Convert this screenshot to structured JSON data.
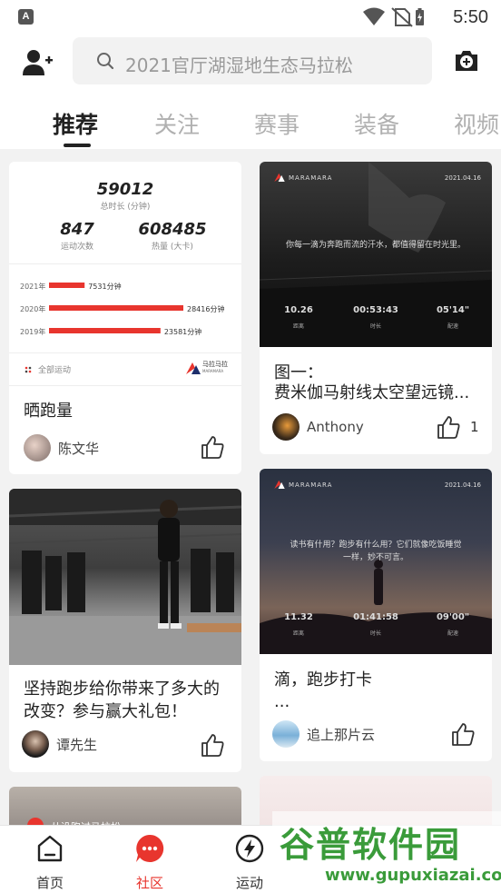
{
  "status": {
    "app_badge": "A",
    "time": "5:50"
  },
  "search": {
    "placeholder": "2021官厅湖湿地生态马拉松"
  },
  "tabs": [
    {
      "label": "推荐",
      "active": true
    },
    {
      "label": "关注"
    },
    {
      "label": "赛事"
    },
    {
      "label": "装备"
    },
    {
      "label": "视频"
    }
  ],
  "cards": {
    "stats": {
      "total_value": "59012",
      "total_label": "总时长 (分钟)",
      "runs_value": "847",
      "runs_label": "运动次数",
      "cal_value": "608485",
      "cal_label": "热量 (大卡)",
      "bars": [
        {
          "year": "2021年",
          "value": "7531分钟",
          "minutes": 7531
        },
        {
          "year": "2020年",
          "value": "28416分钟",
          "minutes": 28416
        },
        {
          "year": "2019年",
          "value": "23581分钟",
          "minutes": 23581
        }
      ],
      "footer_left": "全部运动",
      "footer_brand": "马拉马拉",
      "footer_brand_sub": "MARAMARA",
      "title": "晒跑量",
      "author": "陈文华"
    },
    "poster1": {
      "brand": "MARAMARA",
      "date": "2021.04.16",
      "quote": "你每一滴为奔跑而流的汗水，都值得留在时光里。",
      "metrics": [
        {
          "value": "10.26",
          "label": "距离"
        },
        {
          "value": "00:53:43",
          "label": "时长"
        },
        {
          "value": "05'14\"",
          "label": "配速"
        }
      ],
      "title_line1": "图一：",
      "title_line2": "费米伽马射线太空望远镜...",
      "author": "Anthony",
      "likes": "1"
    },
    "gym": {
      "title": "坚持跑步给你带来了多大的改变？参与赢大礼包！",
      "author": "谭先生"
    },
    "poster2": {
      "brand": "MARAMARA",
      "date": "2021.04.16",
      "quote_line1": "读书有什用？跑步有什么用？它们就像吃饭睡觉",
      "quote_line2": "一样，妙不可言。",
      "metrics": [
        {
          "value": "11.32",
          "label": "距离"
        },
        {
          "value": "01:41:58",
          "label": "时长"
        },
        {
          "value": "09'00\"",
          "label": "配速"
        }
      ],
      "title_line1": "滴，跑步打卡",
      "title_line2": "...",
      "author": "追上那片云"
    },
    "partial_left": {
      "text": "从没跑过马拉松"
    }
  },
  "nav": [
    {
      "label": "首页",
      "icon": "home-icon"
    },
    {
      "label": "社区",
      "icon": "community-icon",
      "active": true
    },
    {
      "label": "运动",
      "icon": "lightning-icon"
    }
  ],
  "watermark": {
    "big": "谷普软件园",
    "small": "www.gupuxiazai.com"
  },
  "colors": {
    "accent": "#e8352e",
    "watermark": "#3a9b3a"
  }
}
